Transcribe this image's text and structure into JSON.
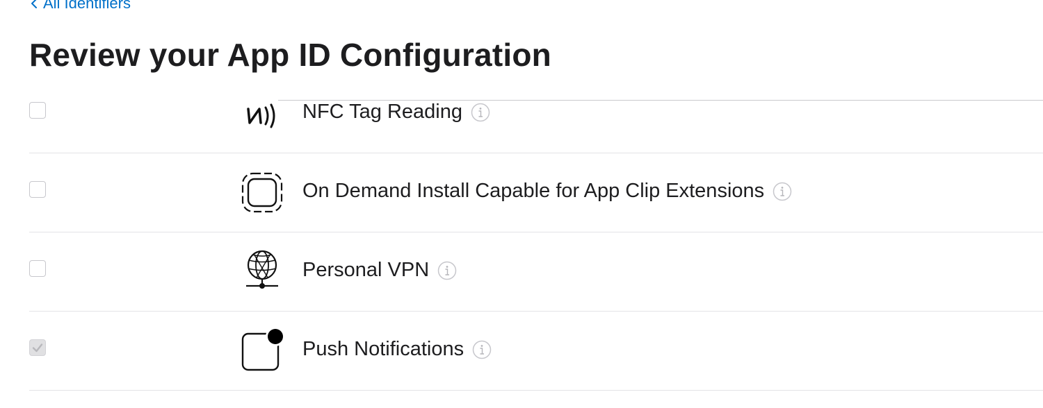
{
  "nav": {
    "back_label": "All Identifiers"
  },
  "page": {
    "title": "Review your App ID Configuration"
  },
  "capabilities": [
    {
      "label": "NFC Tag Reading",
      "icon": "nfc-icon",
      "checked": false
    },
    {
      "label": "On Demand Install Capable for App Clip Extensions",
      "icon": "app-clip-icon",
      "checked": false
    },
    {
      "label": "Personal VPN",
      "icon": "vpn-globe-icon",
      "checked": false
    },
    {
      "label": "Push Notifications",
      "icon": "push-notification-icon",
      "checked": true
    }
  ],
  "colors": {
    "link": "#0070c9",
    "text": "#1d1d1f",
    "divider": "#e3e3e6",
    "info_icon": "#c7c7cc"
  }
}
